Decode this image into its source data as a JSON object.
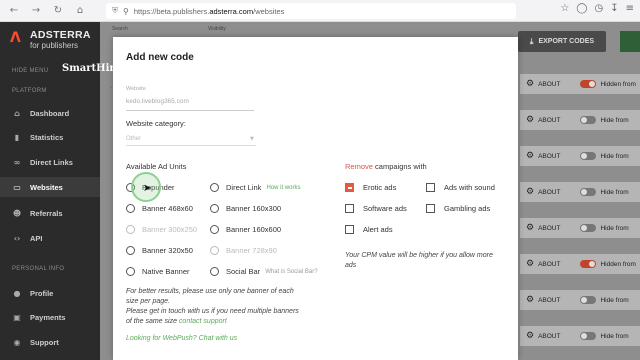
{
  "browser": {
    "url_prefix": "https://beta.publishers.",
    "url_domain": "adsterra.com",
    "url_suffix": "/websites"
  },
  "logo": {
    "name": "ADSTERRA",
    "sub": "for publishers"
  },
  "watermark": "SmartHindi",
  "sidebar": {
    "hide_menu": "HIDE MENU",
    "platform": "PLATFORM",
    "personal": "PERSONAL INFO",
    "items": [
      {
        "label": "Dashboard",
        "icon": "home-icon"
      },
      {
        "label": "Statistics",
        "icon": "bar-chart-icon"
      },
      {
        "label": "Direct Links",
        "icon": "link-icon"
      },
      {
        "label": "Websites",
        "icon": "monitor-icon"
      },
      {
        "label": "Referrals",
        "icon": "users-icon"
      },
      {
        "label": "API",
        "icon": "code-icon"
      }
    ],
    "personal_items": [
      {
        "label": "Profile",
        "icon": "user-icon"
      },
      {
        "label": "Payments",
        "icon": "wallet-icon"
      },
      {
        "label": "Support",
        "icon": "support-icon"
      }
    ]
  },
  "background": {
    "search_label": "Search",
    "visibility_label": "Visibility",
    "export_label": "EXPORT CODES",
    "about_label": "ABOUT",
    "hidden_label": "Hidden from",
    "hide_label": "Hide from"
  },
  "modal": {
    "title": "Add new code",
    "website_label": "Website",
    "website_value": "kedo.liveblog365.com",
    "category_label": "Website category:",
    "category_placeholder": "Other",
    "units_label": "Available Ad Units",
    "ad_units": [
      {
        "label": "Popunder",
        "hint": ""
      },
      {
        "label": "Direct Link",
        "hint": "How it works"
      },
      {
        "label": "Banner 468x60",
        "hint": ""
      },
      {
        "label": "Banner 160x300",
        "hint": ""
      },
      {
        "label": "Banner 300x250",
        "hint": ""
      },
      {
        "label": "Banner 160x600",
        "hint": ""
      },
      {
        "label": "Banner 320x50",
        "hint": ""
      },
      {
        "label": "Banner 728x90",
        "hint": ""
      },
      {
        "label": "Native Banner",
        "hint": ""
      },
      {
        "label": "Social Bar",
        "hint": "What is Social Bar?"
      }
    ],
    "remove_word": "Remove",
    "remove_rest": " campaigns with",
    "campaigns": [
      {
        "label": "Erotic ads",
        "checked": true
      },
      {
        "label": "Ads with sound",
        "checked": false
      },
      {
        "label": "Software ads",
        "checked": false
      },
      {
        "label": "Gambling ads",
        "checked": false
      },
      {
        "label": "Alert ads",
        "checked": false
      }
    ],
    "cpm_note": "Your CPM value will be higher if you allow more ads",
    "note_text": "For better results, please use only one banner of each size per page.\nPlease get in touch with us if you need multiple banners of the same size ",
    "note_link": "contact support",
    "webpush": "Looking for WebPush? Chat with us"
  },
  "colors": {
    "accent_green": "#5aaa5a",
    "accent_red": "#d9534f",
    "sidebar_bg": "#2b2b2b"
  }
}
